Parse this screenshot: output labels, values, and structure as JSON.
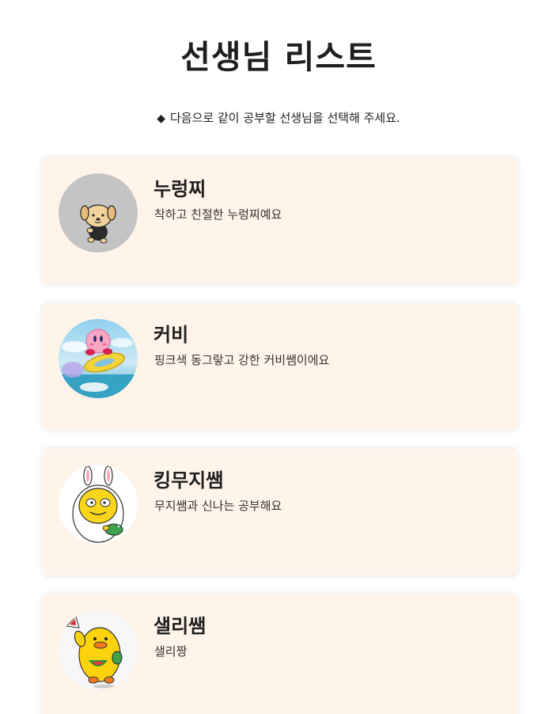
{
  "page": {
    "title": "선생님 리스트",
    "instruction_icon": "◆",
    "instruction": "다음으로 같이 공부할 선생님을 선택해 주세요."
  },
  "teachers": [
    {
      "name": "누렁찌",
      "description": "착하고 친절한 누렁찌예요",
      "avatar_icon": "puppy-icon"
    },
    {
      "name": "커비",
      "description": "핑크색 동그랗고 강한 커비쌤이에요",
      "avatar_icon": "kirby-icon"
    },
    {
      "name": "킹무지쌤",
      "description": "무지쌤과 신나는 공부해요",
      "avatar_icon": "muzi-icon"
    },
    {
      "name": "샐리쌤",
      "description": "샐리짱",
      "avatar_icon": "sally-icon"
    }
  ],
  "colors": {
    "card_background": "#fff4ea",
    "text": "#222222"
  }
}
